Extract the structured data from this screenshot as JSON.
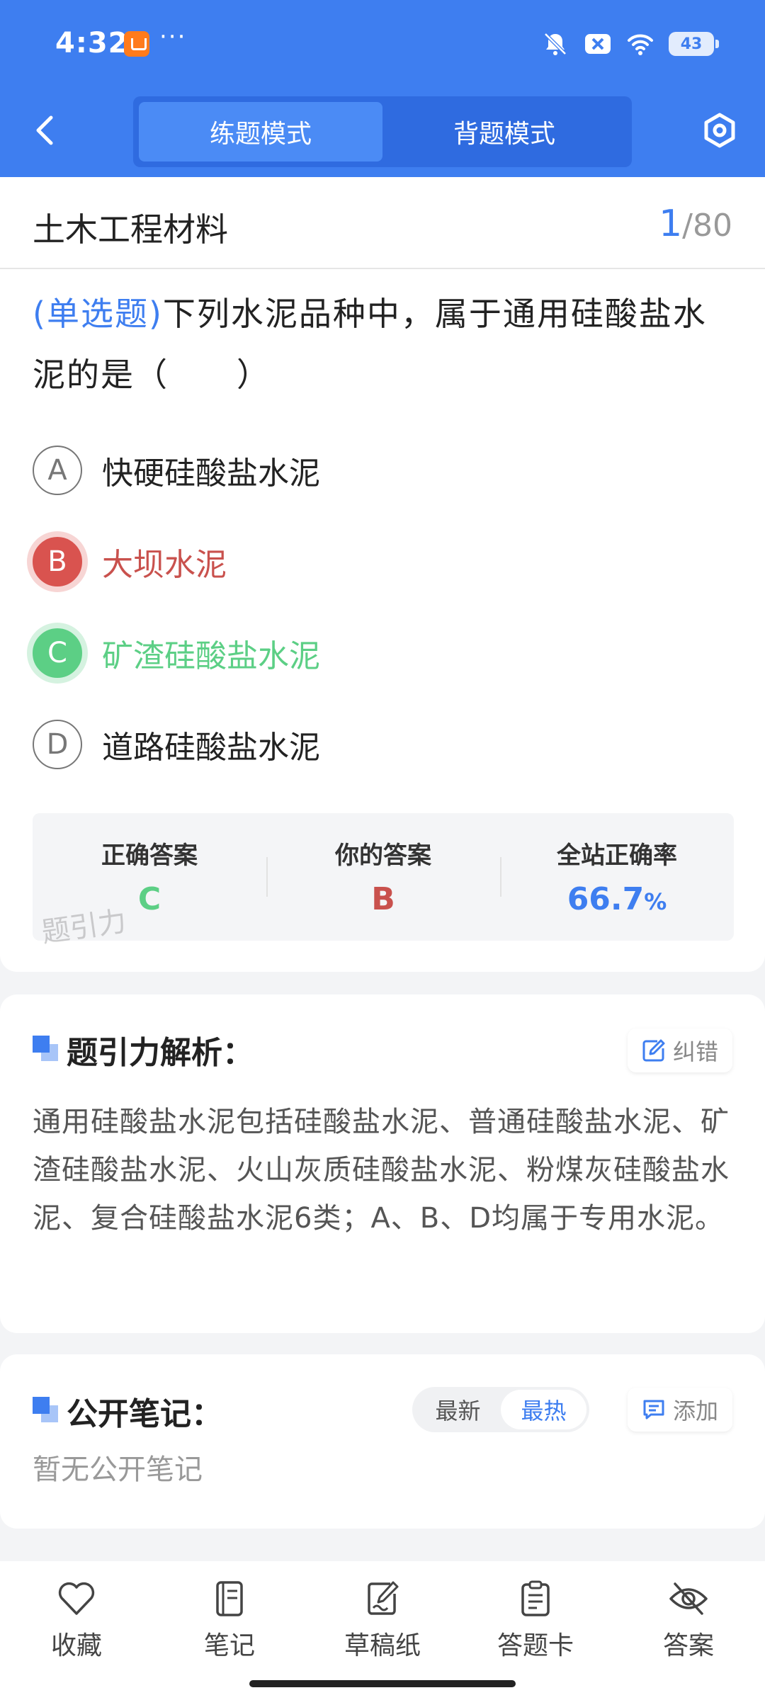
{
  "status_bar": {
    "time": "4:32",
    "dots": "···",
    "battery": "43"
  },
  "header": {
    "mode_tabs": [
      "练题模式",
      "背题模式"
    ],
    "active_mode": 0
  },
  "question": {
    "subject": "土木工程材料",
    "current": "1",
    "separator": "/",
    "total": "80",
    "type_label": "(单选题)",
    "text": "下列水泥品种中，属于通用硅酸盐水泥的是（　　）",
    "options": [
      {
        "letter": "A",
        "text": "快硬硅酸盐水泥",
        "state": "normal"
      },
      {
        "letter": "B",
        "text": "大坝水泥",
        "state": "wrong"
      },
      {
        "letter": "C",
        "text": "矿渣硅酸盐水泥",
        "state": "correct"
      },
      {
        "letter": "D",
        "text": "道路硅酸盐水泥",
        "state": "normal"
      }
    ]
  },
  "answer_summary": {
    "correct_label": "正确答案",
    "correct_value": "C",
    "yours_label": "你的答案",
    "yours_value": "B",
    "rate_label": "全站正确率",
    "rate_value": "66.7",
    "rate_unit": "%",
    "watermark": "题引力"
  },
  "analysis": {
    "title": "题引力解析：",
    "report_label": "纠错",
    "text": "通用硅酸盐水泥包括硅酸盐水泥、普通硅酸盐水泥、矿渣硅酸盐水泥、火山灰质硅酸盐水泥、粉煤灰硅酸盐水泥、复合硅酸盐水泥6类；A、B、D均属于专用水泥。"
  },
  "notes": {
    "title": "公开笔记：",
    "sort_options": [
      "最新",
      "最热"
    ],
    "active_sort": 1,
    "add_label": "添加",
    "empty_text": "暂无公开笔记"
  },
  "bottom_nav": [
    {
      "label": "收藏",
      "icon": "heart-icon"
    },
    {
      "label": "笔记",
      "icon": "notebook-icon"
    },
    {
      "label": "草稿纸",
      "icon": "draft-icon"
    },
    {
      "label": "答题卡",
      "icon": "clipboard-icon"
    },
    {
      "label": "答案",
      "icon": "eye-off-icon"
    }
  ],
  "colors": {
    "primary": "#3e7ef0",
    "wrong": "#c9514d",
    "correct": "#5ccf85"
  }
}
